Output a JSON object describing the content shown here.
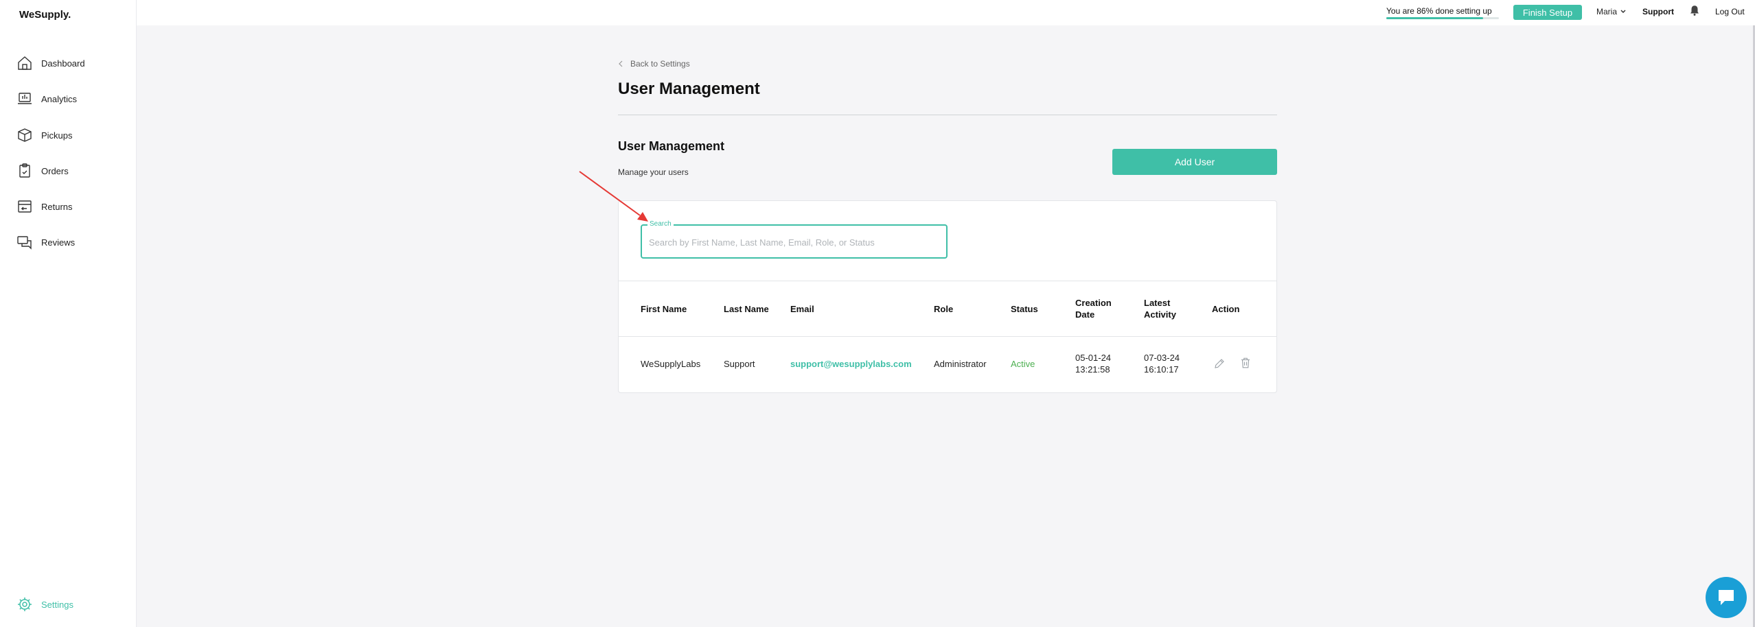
{
  "brand": {
    "logo": "WeSupply."
  },
  "sidebar": {
    "items": [
      {
        "label": "Dashboard",
        "icon": "home-icon"
      },
      {
        "label": "Analytics",
        "icon": "analytics-icon"
      },
      {
        "label": "Pickups",
        "icon": "box-icon"
      },
      {
        "label": "Orders",
        "icon": "clipboard-icon"
      },
      {
        "label": "Returns",
        "icon": "returns-icon"
      },
      {
        "label": "Reviews",
        "icon": "reviews-icon"
      }
    ],
    "settings": {
      "label": "Settings",
      "icon": "gear-icon"
    }
  },
  "topbar": {
    "progress_label": "You are 86% done setting up",
    "progress_percent": 86,
    "finish_label": "Finish Setup",
    "user_name": "Maria",
    "support_label": "Support",
    "logout_label": "Log Out"
  },
  "page": {
    "back_label": "Back to Settings",
    "title": "User Management",
    "section_title": "User Management",
    "section_subtitle": "Manage your users",
    "add_user_label": "Add User"
  },
  "search": {
    "legend": "Search",
    "placeholder": "Search by First Name, Last Name, Email, Role, or Status",
    "value": ""
  },
  "table": {
    "headers": {
      "first_name": "First Name",
      "last_name": "Last Name",
      "email": "Email",
      "role": "Role",
      "status": "Status",
      "creation_date_1": "Creation",
      "creation_date_2": "Date",
      "latest_activity_1": "Latest",
      "latest_activity_2": "Activity",
      "action": "Action"
    },
    "rows": [
      {
        "first_name": "WeSupplyLabs",
        "last_name": "Support",
        "email": "support@wesupplylabs.com",
        "role": "Administrator",
        "status": "Active",
        "creation_date": "05-01-24",
        "creation_time": "13:21:58",
        "latest_date": "07-03-24",
        "latest_time": "16:10:17"
      }
    ]
  },
  "colors": {
    "accent": "#3fbfa7",
    "status_active": "#4caf50",
    "annotation_arrow": "#e53935",
    "chat": "#1a9fd6"
  }
}
